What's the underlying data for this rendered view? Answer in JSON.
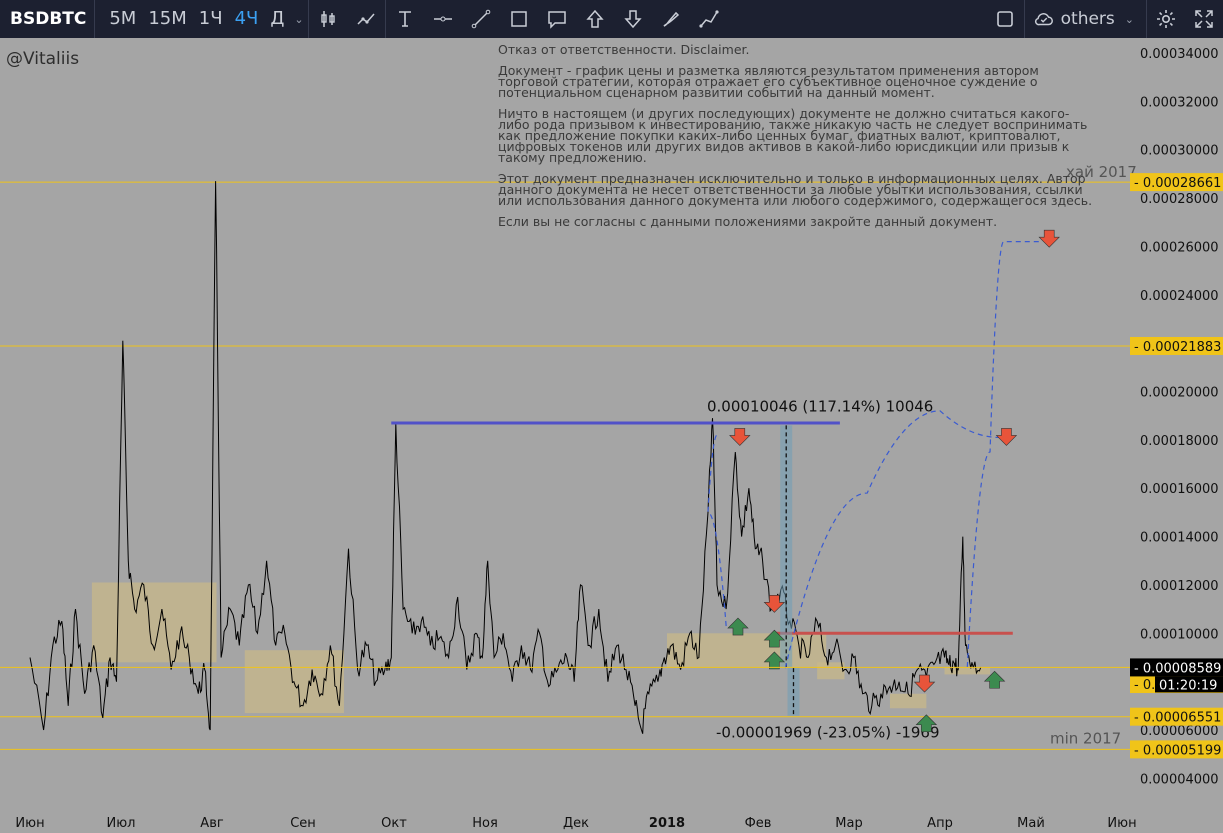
{
  "toolbar": {
    "symbol": "BSDBTC",
    "timeframes": [
      {
        "label": "5М",
        "active": false
      },
      {
        "label": "15М",
        "active": false
      },
      {
        "label": "1Ч",
        "active": false
      },
      {
        "label": "4Ч",
        "active": true
      },
      {
        "label": "Д",
        "active": false
      }
    ],
    "tools": [
      "candle-style-icon",
      "indicators-icon",
      "text-tool-icon",
      "horizontal-line-icon",
      "trend-line-icon",
      "rectangle-icon",
      "callout-icon",
      "arrow-up-icon",
      "arrow-down-icon",
      "brush-icon",
      "path-icon"
    ],
    "others_label": "others"
  },
  "watermark": "@Vitaliis",
  "disclaimer": [
    "Отказ от ответственности. Disclaimer.",
    "Документ - график цены и разметка являются результатом применения автором торговой стратегии, которая отражает его субъективное оценочное суждение о потенциальном сценарном развитии событий на данный момент.",
    "Ничто в настоящем (и других последующих) документе не должно считаться какого-либо рода призывом к инвестированию, также никакую часть не следует воспринимать как предложение покупки каких-либо ценных бумаг, фиатных валют, криптовалют, цифровых токенов или других видов активов в какой-либо юрисдикции или призыв к такому предложению.",
    "Этот документ предназначен исключительно и только в информационных целях. Автор данного документа не несет ответственности за любые убытки использования, ссылки или использования данного документа или любого содержимого, содержащегося здесь.",
    "Если вы не согласны с данными положениями закройте данный документ."
  ],
  "chart_data": {
    "type": "line",
    "title": "BSDBTC",
    "interval": "4Ч",
    "ylim": [
      3.85e-05,
      0.00034
    ],
    "y_ticks": [
      "0.00034000",
      "0.00032000",
      "0.00030000",
      "0.00028000",
      "0.00026000",
      "0.00024000",
      "0.00022000",
      "0.00020000",
      "0.00018000",
      "0.00016000",
      "0.00014000",
      "0.00012000",
      "0.00010000",
      "0.00008000",
      "0.00006000",
      "0.00004000"
    ],
    "x_labels": [
      "Июн",
      "Июл",
      "Авг",
      "Сен",
      "Окт",
      "Ноя",
      "Дек",
      "2018",
      "Фев",
      "Мар",
      "Апр",
      "Май",
      "Июн"
    ],
    "series": [
      {
        "points": [
          [
            0,
            9e-05
          ],
          [
            0.15,
            6e-05
          ],
          [
            0.25,
            9.5e-05
          ],
          [
            0.35,
            0.000105
          ],
          [
            0.42,
            7e-05
          ],
          [
            0.5,
            0.00011
          ],
          [
            0.6,
            7.5e-05
          ],
          [
            0.7,
            9.5e-05
          ],
          [
            0.8,
            6.5e-05
          ],
          [
            0.88,
            9e-05
          ],
          [
            0.95,
            8e-05
          ],
          [
            1.02,
            0.000221
          ],
          [
            1.08,
            0.00013
          ],
          [
            1.15,
            0.00011
          ],
          [
            1.25,
            0.00012
          ],
          [
            1.35,
            9.5e-05
          ],
          [
            1.45,
            0.00011
          ],
          [
            1.55,
            8.5e-05
          ],
          [
            1.65,
            0.0001
          ],
          [
            1.75,
            9e-05
          ],
          [
            1.85,
            7.5e-05
          ],
          [
            1.92,
            8.5e-05
          ],
          [
            1.98,
            6e-05
          ],
          [
            2.04,
            0.000287
          ],
          [
            2.1,
            9e-05
          ],
          [
            2.2,
            0.00011
          ],
          [
            2.3,
            9.5e-05
          ],
          [
            2.4,
            0.00012
          ],
          [
            2.5,
            0.0001
          ],
          [
            2.6,
            0.00013
          ],
          [
            2.7,
            9.5e-05
          ],
          [
            2.8,
            0.0001
          ],
          [
            2.9,
            8e-05
          ],
          [
            3.0,
            7e-05
          ],
          [
            3.1,
            8.5e-05
          ],
          [
            3.2,
            7.5e-05
          ],
          [
            3.3,
            9.5e-05
          ],
          [
            3.4,
            7e-05
          ],
          [
            3.5,
            0.000135
          ],
          [
            3.6,
            8.5e-05
          ],
          [
            3.7,
            9.5e-05
          ],
          [
            3.8,
            8e-05
          ],
          [
            3.9,
            8.5e-05
          ],
          [
            3.97,
            9e-05
          ],
          [
            4.02,
            0.000187
          ],
          [
            4.1,
            0.00011
          ],
          [
            4.2,
            0.0001
          ],
          [
            4.3,
            0.000105
          ],
          [
            4.4,
            9.5e-05
          ],
          [
            4.5,
            9.8e-05
          ],
          [
            4.6,
            9e-05
          ],
          [
            4.7,
            0.000115
          ],
          [
            4.8,
            8.5e-05
          ],
          [
            4.9,
            0.0001
          ],
          [
            4.97,
            9e-05
          ],
          [
            5.03,
            0.00013
          ],
          [
            5.1,
            9e-05
          ],
          [
            5.2,
            0.0001
          ],
          [
            5.3,
            8e-05
          ],
          [
            5.4,
            9.5e-05
          ],
          [
            5.5,
            8.5e-05
          ],
          [
            5.6,
            0.0001
          ],
          [
            5.7,
            7.8e-05
          ],
          [
            5.8,
            8.5e-05
          ],
          [
            5.9,
            9e-05
          ],
          [
            5.98,
            8e-05
          ],
          [
            6.05,
            0.00012
          ],
          [
            6.15,
            9.5e-05
          ],
          [
            6.25,
            0.00011
          ],
          [
            6.35,
            8e-05
          ],
          [
            6.45,
            9.5e-05
          ],
          [
            6.55,
            8.5e-05
          ],
          [
            6.65,
            7e-05
          ],
          [
            6.72,
            6e-05
          ],
          [
            6.8,
            7.5e-05
          ],
          [
            6.9,
            8e-05
          ],
          [
            6.97,
            9e-05
          ],
          [
            7.05,
            9.5e-05
          ],
          [
            7.15,
            8.5e-05
          ],
          [
            7.25,
            0.0001
          ],
          [
            7.35,
            9e-05
          ],
          [
            7.45,
            0.00015
          ],
          [
            7.5,
            0.000189
          ],
          [
            7.55,
            0.00012
          ],
          [
            7.65,
            0.00011
          ],
          [
            7.75,
            0.000175
          ],
          [
            7.82,
            0.00014
          ],
          [
            7.9,
            0.00016
          ],
          [
            7.97,
            0.000135
          ],
          [
            8.05,
            0.00013
          ],
          [
            8.15,
            0.00011
          ],
          [
            8.25,
            0.000118
          ],
          [
            8.35,
            0.000105
          ],
          [
            8.45,
            9.5e-05
          ],
          [
            8.55,
            9e-05
          ],
          [
            8.65,
            0.000105
          ],
          [
            8.75,
            9e-05
          ],
          [
            8.85,
            9.5e-05
          ],
          [
            8.95,
            8.5e-05
          ],
          [
            9.05,
            9e-05
          ],
          [
            9.15,
            7.5e-05
          ],
          [
            9.25,
            7e-05
          ],
          [
            9.35,
            7.5e-05
          ],
          [
            9.45,
            7.8e-05
          ],
          [
            9.55,
            8e-05
          ],
          [
            9.65,
            7.5e-05
          ],
          [
            9.75,
            8.5e-05
          ],
          [
            9.85,
            8.2e-05
          ],
          [
            9.95,
            8.8e-05
          ],
          [
            10.05,
            9e-05
          ],
          [
            10.1,
            8.7e-05
          ],
          [
            10.15,
            8.8e-05
          ],
          [
            10.2,
            8.5e-05
          ],
          [
            10.25,
            0.00014
          ],
          [
            10.28,
            9.5e-05
          ],
          [
            10.35,
            8.8e-05
          ],
          [
            10.45,
            8.6e-05
          ]
        ]
      }
    ],
    "levels": [
      {
        "label": "0.00028661",
        "value": 0.00028661,
        "note": "хай 2017"
      },
      {
        "label": "0.00021883",
        "value": 0.00021883,
        "note": ""
      },
      {
        "label": "0.00006551",
        "value": 6.551e-05,
        "note": ""
      },
      {
        "label": "0.00005199",
        "value": 5.199e-05,
        "note": "min 2017"
      }
    ],
    "current_price": {
      "label": "0.00008589",
      "value": 8.589e-05,
      "countdown": "01:20:19"
    },
    "extra_price_label": {
      "label": "0.00008564",
      "value": 8.564e-05
    },
    "zones": [
      {
        "x0": 0.68,
        "x1": 2.05,
        "y0": 8.8e-05,
        "y1": 0.000121
      },
      {
        "x0": 2.36,
        "x1": 3.45,
        "y0": 6.7e-05,
        "y1": 9.3e-05
      },
      {
        "x0": 7.0,
        "x1": 8.75,
        "y0": 8.6e-05,
        "y1": 0.0001
      },
      {
        "x0": 8.65,
        "x1": 8.95,
        "y0": 8.1e-05,
        "y1": 8.8e-05
      },
      {
        "x0": 9.45,
        "x1": 9.85,
        "y0": 6.9e-05,
        "y1": 7.5e-05
      },
      {
        "x0": 10.05,
        "x1": 10.55,
        "y0": 8.3e-05,
        "y1": 8.6e-05
      }
    ],
    "resistance_line": {
      "x0": 3.97,
      "x1": 8.9,
      "value": 0.000187
    },
    "red_line": {
      "x0": 8.2,
      "x1": 10.8,
      "value": 0.0001
    },
    "measure_up": {
      "x": 8.31,
      "from": 8.56e-05,
      "to": 0.000186,
      "label": "0.00010046 (117.14%) 10046"
    },
    "measure_down": {
      "x": 8.39,
      "from": 8.56e-05,
      "to": 6.59e-05,
      "label": "-0.00001969 (-23.05%) -1969"
    },
    "forecast_paths": [
      {
        "points": [
          [
            8.3,
            8.56e-05
          ],
          [
            9.2,
            0.000158
          ],
          [
            10.0,
            0.000192
          ],
          [
            10.65,
            0.000181
          ]
        ]
      },
      {
        "points": [
          [
            10.3,
            8.6e-05
          ],
          [
            10.55,
            0.000175
          ],
          [
            10.7,
            0.000262
          ],
          [
            11.1,
            0.000262
          ]
        ]
      },
      {
        "points": [
          [
            7.65,
            0.000103
          ],
          [
            7.45,
            0.00015
          ],
          [
            7.55,
            0.000182
          ]
        ]
      }
    ],
    "markers": [
      {
        "dir": "down",
        "x": 7.8,
        "y": 0.000181
      },
      {
        "dir": "down",
        "x": 10.73,
        "y": 0.000181
      },
      {
        "dir": "down",
        "x": 11.2,
        "y": 0.000263
      },
      {
        "dir": "down",
        "x": 8.18,
        "y": 0.000112
      },
      {
        "dir": "down",
        "x": 9.83,
        "y": 7.9e-05
      },
      {
        "dir": "up",
        "x": 7.78,
        "y": 0.000103
      },
      {
        "dir": "up",
        "x": 8.18,
        "y": 9.8e-05
      },
      {
        "dir": "up",
        "x": 8.18,
        "y": 8.9e-05
      },
      {
        "dir": "up",
        "x": 9.85,
        "y": 6.3e-05
      },
      {
        "dir": "up",
        "x": 10.6,
        "y": 8.1e-05
      }
    ],
    "y_axis_labels": [
      "0.00034000",
      "0.00032000",
      "0.00030000",
      "0.00028000",
      "0.00026000",
      "0.00024000",
      "0.00022000",
      "0.00020000",
      "0.00018000",
      "0.00016000",
      "0.00014000",
      "0.00012000",
      "0.00010000",
      "0.00008000",
      "0.00006000",
      "0.00004000"
    ],
    "colors": {
      "background": "#a5a5a5",
      "price": "#000000",
      "level": "#f0c419",
      "resistance": "#5151c8",
      "red_line": "#c8504d",
      "zone": "#c8b88a",
      "forecast": "#3a5bd1",
      "up_marker": "#3c8a4f",
      "down_marker": "#e8543a"
    }
  },
  "fib_note": "хай 2017",
  "min_note": "min 2017"
}
